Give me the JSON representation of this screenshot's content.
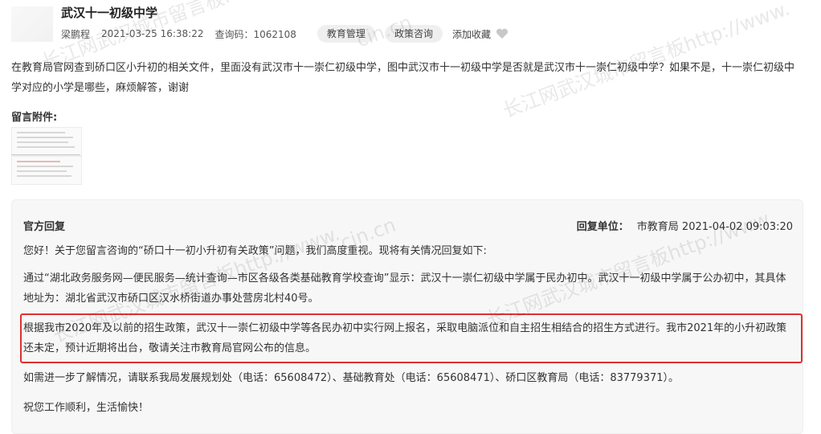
{
  "header": {
    "title": "武汉十一初级中学",
    "author": "梁鹏程",
    "datetime": "2021-03-25 16:38:22",
    "query_code": "查询码：1062108",
    "tags": [
      "教育管理",
      "政策咨询"
    ],
    "favorite_label": "添加收藏"
  },
  "question": {
    "text": "在教育局官网查到硚口区小升初的相关文件，里面没有武汉市十一崇仁初级中学，图中武汉市十一初级中学是否就是武汉市十一崇仁初级中学？如果不是，十一崇仁初级中学对应的小学是哪些，麻烦解答，谢谢"
  },
  "attachments": {
    "label": "留言附件:"
  },
  "reply": {
    "heading": "官方回复",
    "unit_label": "回复单位：",
    "unit_value": "市教育局 2021-04-02 09:03:20",
    "paragraphs": [
      "您好！关于您留言咨询的“硚口十一初小升初有关政策”问题，我们高度重视。现将有关情况回复如下:",
      "通过“湖北政务服务网—便民服务—统计查询—市区各级各类基础教育学校查询”显示：武汉十一崇仁初级中学属于民办初中。武汉十一初级中学属于公办初中，其具体地址为：湖北省武汉市硚口区汉水桥街道办事处营房北村40号。",
      "根据我市2020年及以前的招生政策，武汉十一崇仁初级中学等各民办初中实行网上报名，采取电脑派位和自主招生相结合的招生方式进行。我市2021年的小升初政策还未定，预计近期将出台，敬请关注市教育局官网公布的信息。",
      "如需进一步了解情况，请联系我局发展规划处（电话：65608472）、基础教育处（电话：65608471）、硚口区教育局（电话：83779371）。",
      "祝您工作顺利，生活愉快！"
    ]
  },
  "watermarks": [
    "长江网武汉城市留言板http://www.",
    "长江网武汉城市留言板http://www.",
    "长江网武汉城市留言板http://www.",
    "长江网武汉城市留言板http://www.",
    "cin.cn",
    "cin.cn"
  ],
  "colors": {
    "highlight_border": "#e03030",
    "reply_bg": "#f7f7f7",
    "tag_bg": "#efefef"
  }
}
